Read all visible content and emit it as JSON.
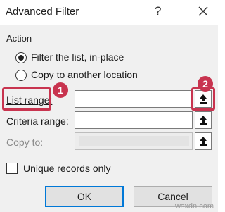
{
  "window": {
    "title": "Advanced Filter",
    "help_label": "?"
  },
  "action": {
    "label": "Action",
    "options": [
      {
        "label": "Filter the list, in-place",
        "selected": true
      },
      {
        "label": "Copy to another location",
        "selected": false
      }
    ]
  },
  "fields": {
    "list_range": {
      "label": "List range:",
      "value": ""
    },
    "criteria_range": {
      "label": "Criteria range:",
      "value": ""
    },
    "copy_to": {
      "label": "Copy to:",
      "value": "",
      "disabled": true
    }
  },
  "annotations": {
    "badge_1": "1",
    "badge_2": "2",
    "highlight_color": "#c8344f"
  },
  "unique_records": {
    "label": "Unique records only",
    "checked": false
  },
  "buttons": {
    "ok": "OK",
    "cancel": "Cancel"
  },
  "watermark": "wsxdn.com",
  "icons": {
    "close": "close-icon",
    "range_picker": "collapse-dialog-arrow-icon"
  },
  "colors": {
    "default_button_border": "#0078d7",
    "dialog_background": "#f0f0f0"
  }
}
